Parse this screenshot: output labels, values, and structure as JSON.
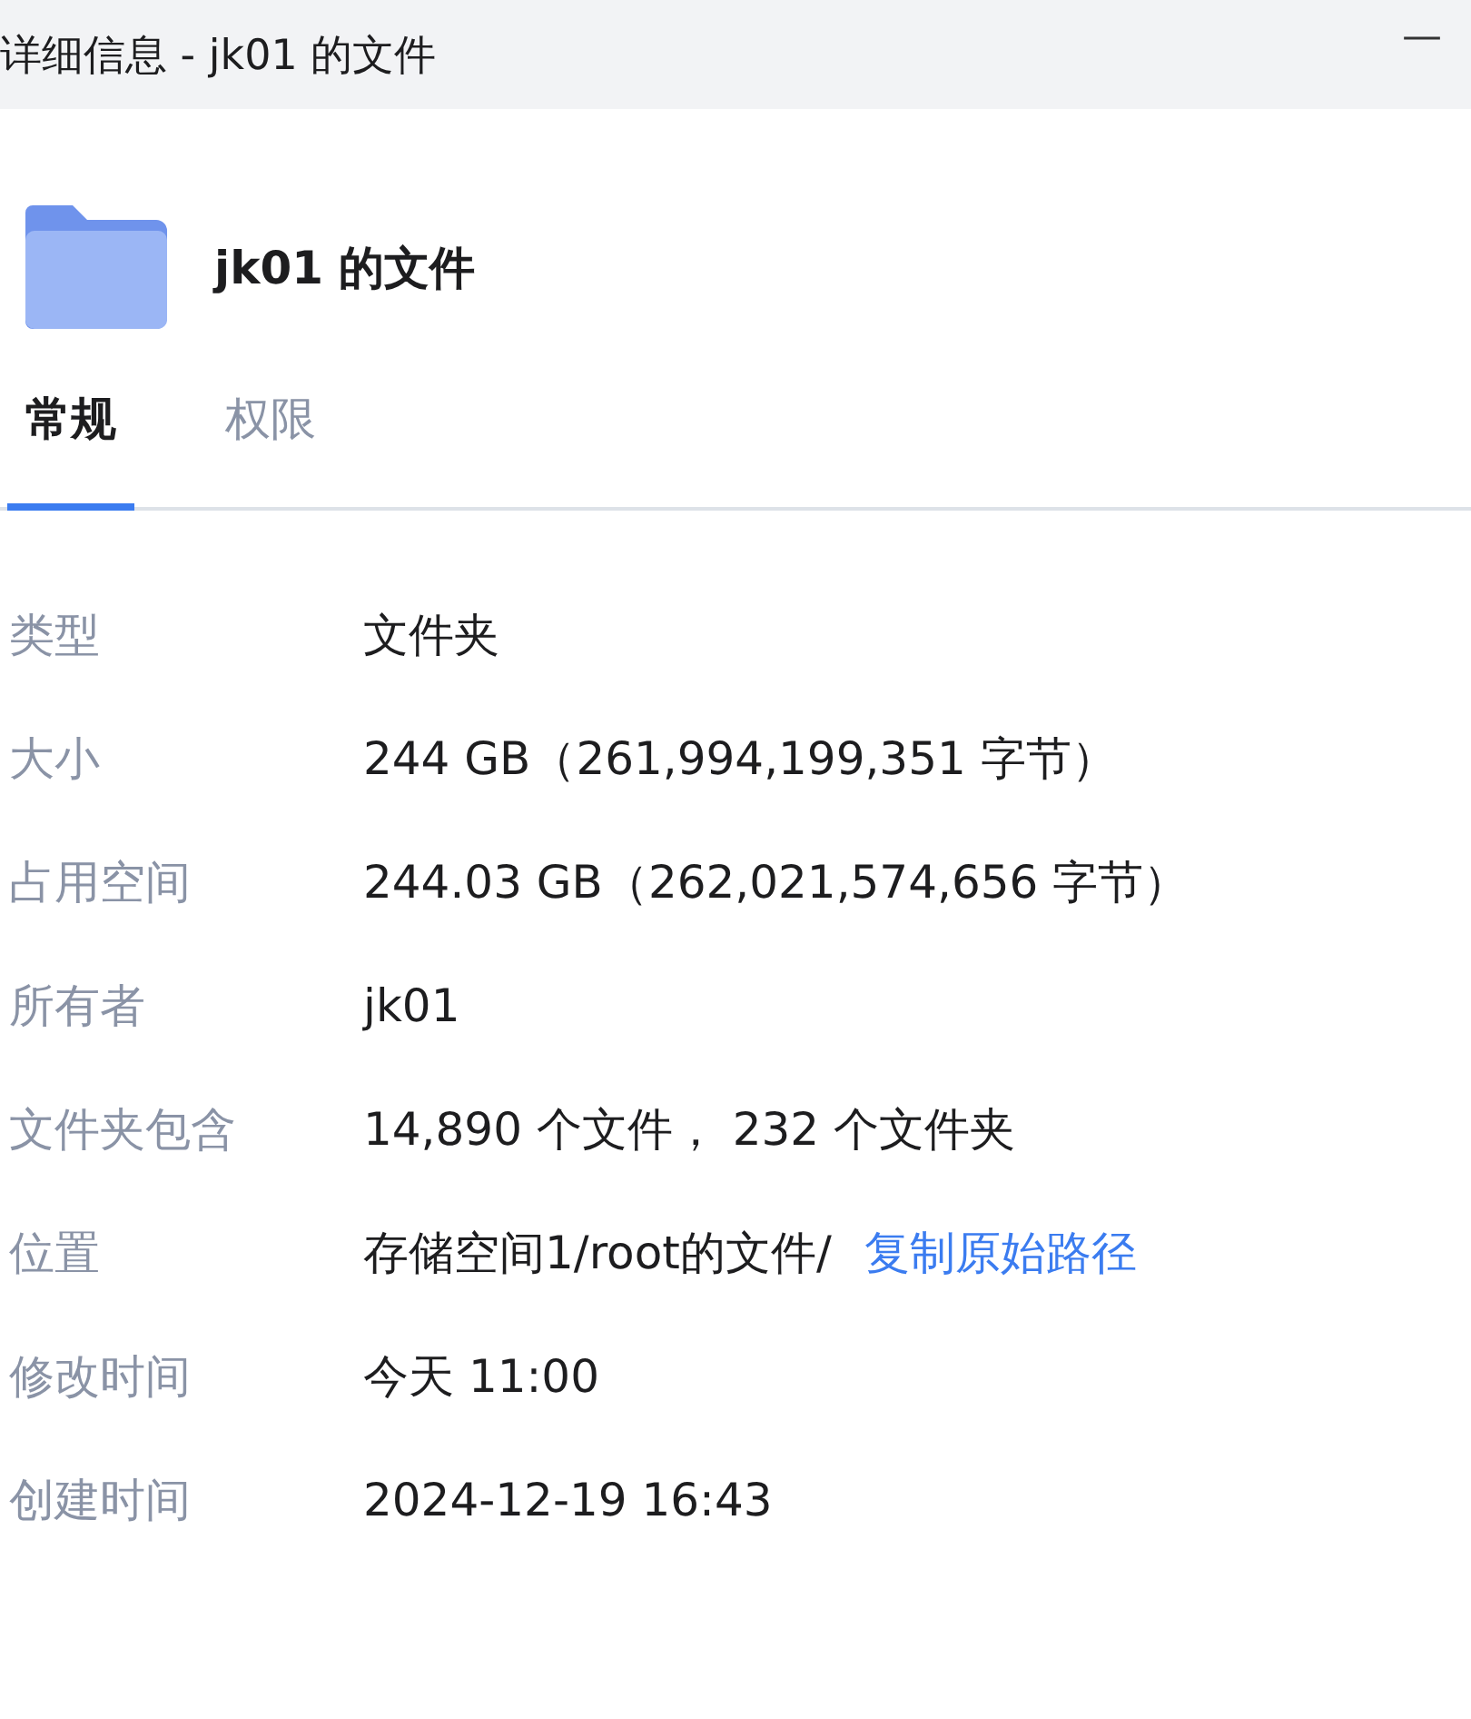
{
  "window": {
    "title": "详细信息 - jk01 的文件",
    "minimize": "—"
  },
  "item": {
    "name": "jk01 的文件"
  },
  "tabs": [
    {
      "label": "常规",
      "selected": true
    },
    {
      "label": "权限",
      "selected": false
    }
  ],
  "properties": [
    {
      "label": "类型",
      "value": "文件夹"
    },
    {
      "label": "大小",
      "value": "244 GB（261,994,199,351 字节）"
    },
    {
      "label": "占用空间",
      "value": "244.03 GB（262,021,574,656 字节）"
    },
    {
      "label": "所有者",
      "value": "jk01"
    },
    {
      "label": "文件夹包含",
      "value": "14,890 个文件， 232 个文件夹"
    },
    {
      "label": "位置",
      "value": "存储空间1/root的文件/",
      "link": "复制原始路径"
    },
    {
      "label": "修改时间",
      "value": "今天 11:00"
    },
    {
      "label": "创建时间",
      "value": "2024-12-19 16:43"
    }
  ]
}
